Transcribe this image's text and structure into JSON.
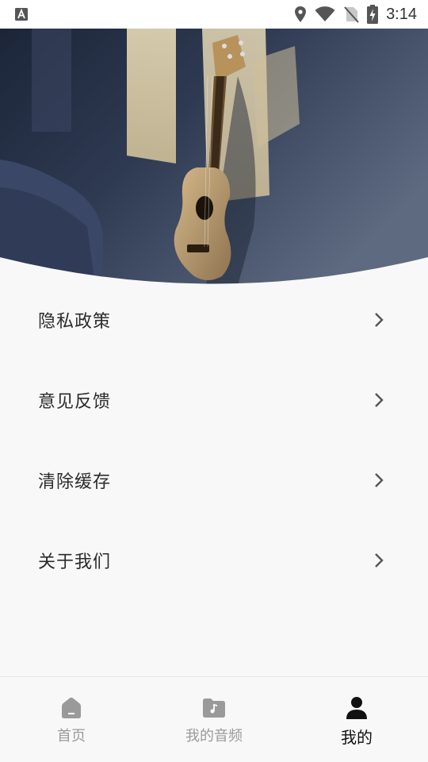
{
  "status_bar": {
    "time": "3:14",
    "icons": [
      "a-app-icon",
      "location-icon",
      "wifi-icon",
      "no-sim-icon",
      "battery-charging-icon"
    ]
  },
  "hero": {
    "image": "ukulele-photo"
  },
  "menu": {
    "items": [
      {
        "label": "隐私政策",
        "icon": "chevron-right-icon"
      },
      {
        "label": "意见反馈",
        "icon": "chevron-right-icon"
      },
      {
        "label": "清除缓存",
        "icon": "chevron-right-icon"
      },
      {
        "label": "关于我们",
        "icon": "chevron-right-icon"
      }
    ]
  },
  "bottom_nav": {
    "tabs": [
      {
        "label": "首页",
        "icon": "home-icon",
        "active": false
      },
      {
        "label": "我的音频",
        "icon": "music-folder-icon",
        "active": false
      },
      {
        "label": "我的",
        "icon": "person-icon",
        "active": true
      }
    ]
  },
  "colors": {
    "background": "#f8f8f8",
    "text_primary": "#2b2b2b",
    "nav_inactive": "#9a9a9a",
    "nav_active": "#111111"
  }
}
